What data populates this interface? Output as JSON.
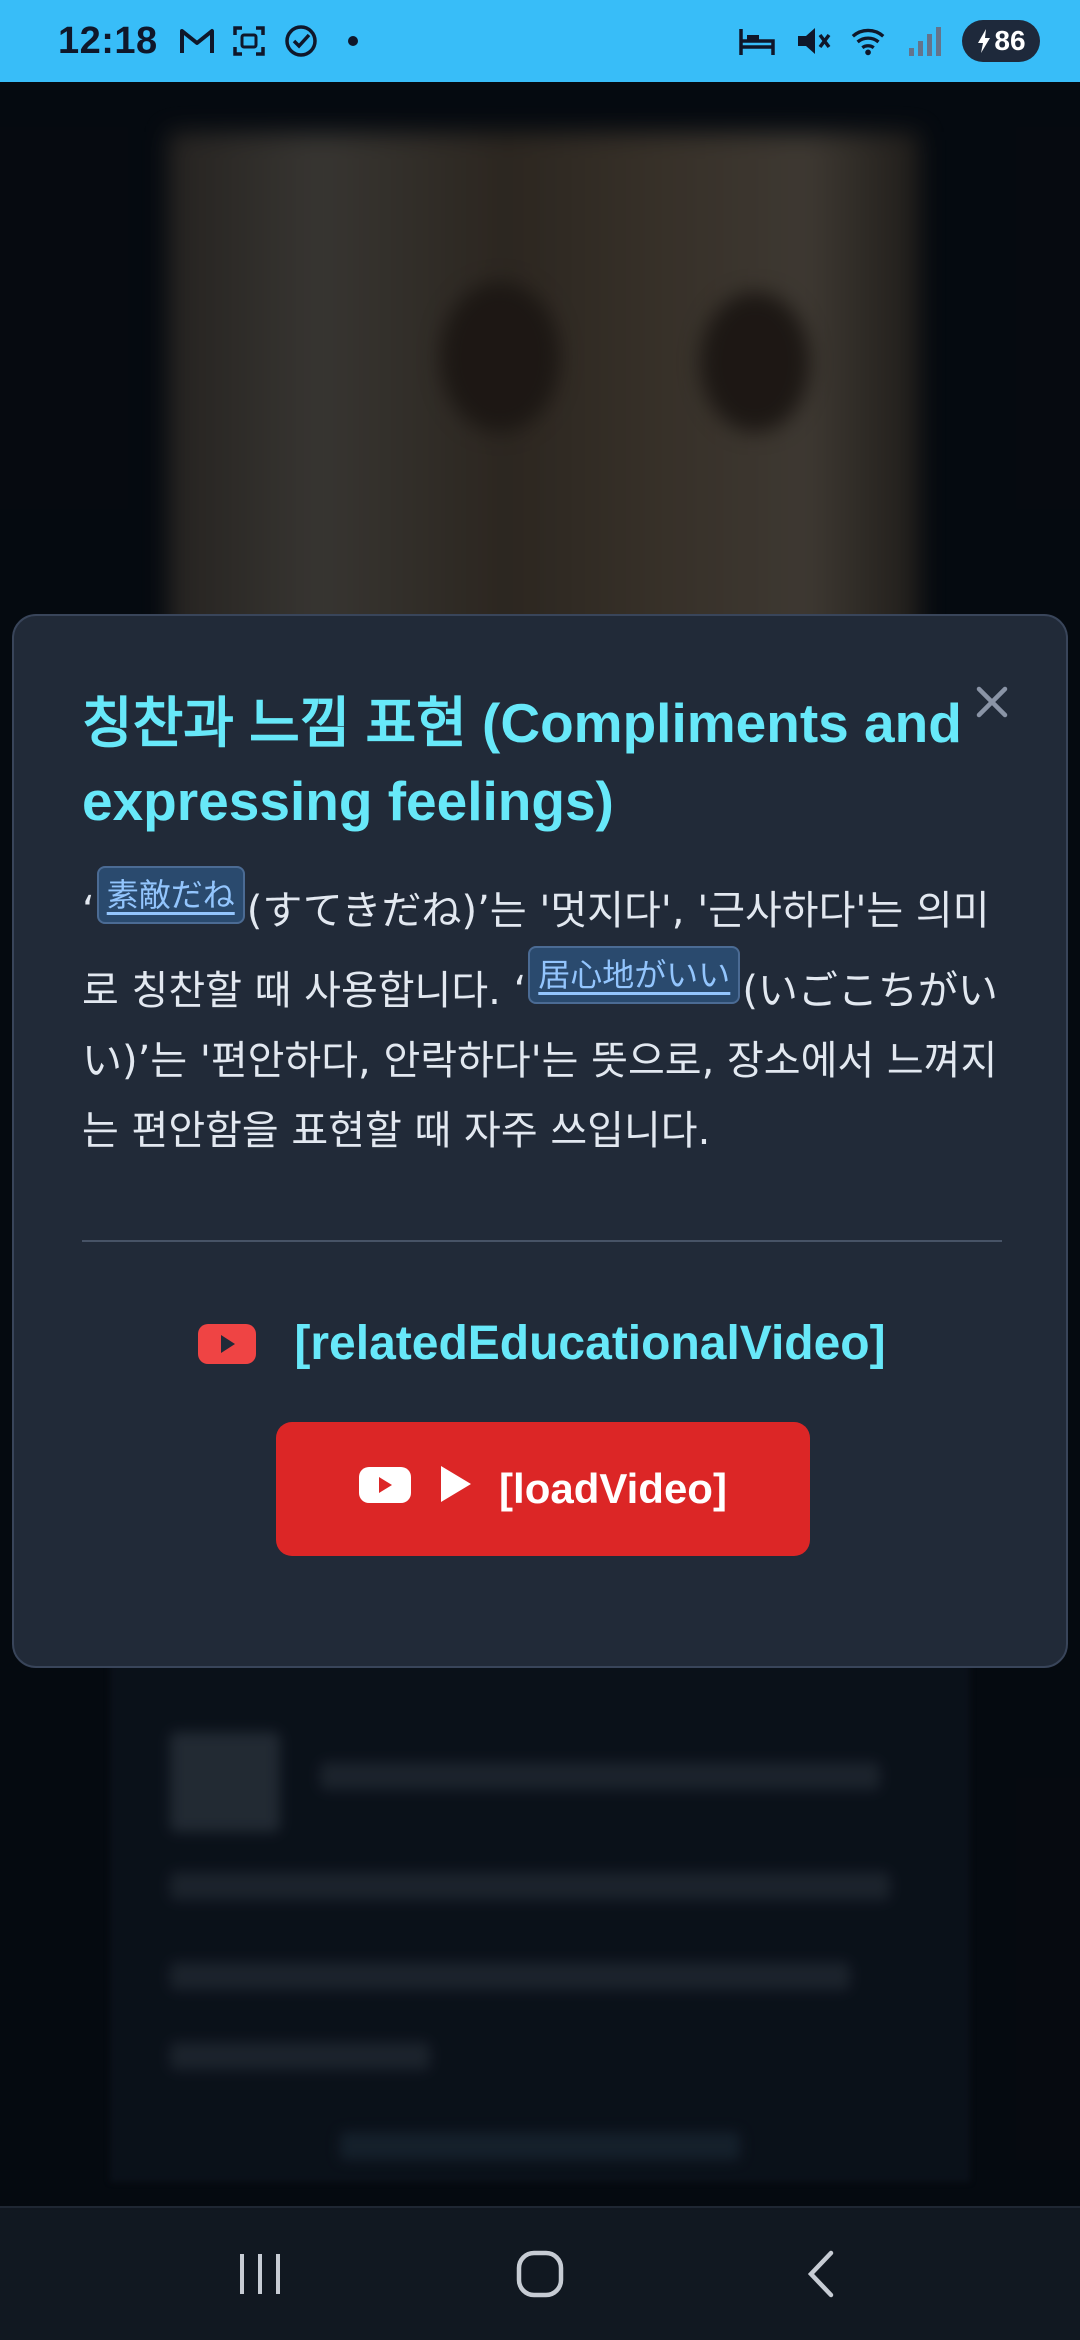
{
  "status_bar": {
    "time": "12:18",
    "left_icons": [
      "gmail-icon",
      "screenshot-icon",
      "check-circle-icon",
      "dot-icon"
    ],
    "right_icons": [
      "bed-icon",
      "mute-icon",
      "wifi-icon",
      "signal-icon"
    ],
    "battery": "86",
    "accent_color": "#38bdf8"
  },
  "modal": {
    "title": "칭찬과 느낌 표현 (Compliments and expressing feelings)",
    "body": {
      "seg1_prefix": "‘",
      "term1": "素敵だね",
      "seg1_suffix": "(すてきだね)’는 '멋지다', '근사하다'는 의미로 칭찬할 때 사용합니다. ‘",
      "term2": "居心地がいい",
      "seg2_suffix": "(いごこちがいい)’는 '편안하다, 안락하다'는 뜻으로, 장소에서 느껴지는 편안함을 표현할 때 자주 쓰입니다."
    },
    "video_heading": "[relatedEducationalVideo]",
    "load_video_label": "[loadVideo]",
    "colors": {
      "title": "#67e8f9",
      "button": "#dc2626",
      "panel": "#212a38"
    }
  },
  "nav_bar": {
    "buttons": [
      "recent-apps-icon",
      "home-icon",
      "back-icon"
    ]
  }
}
